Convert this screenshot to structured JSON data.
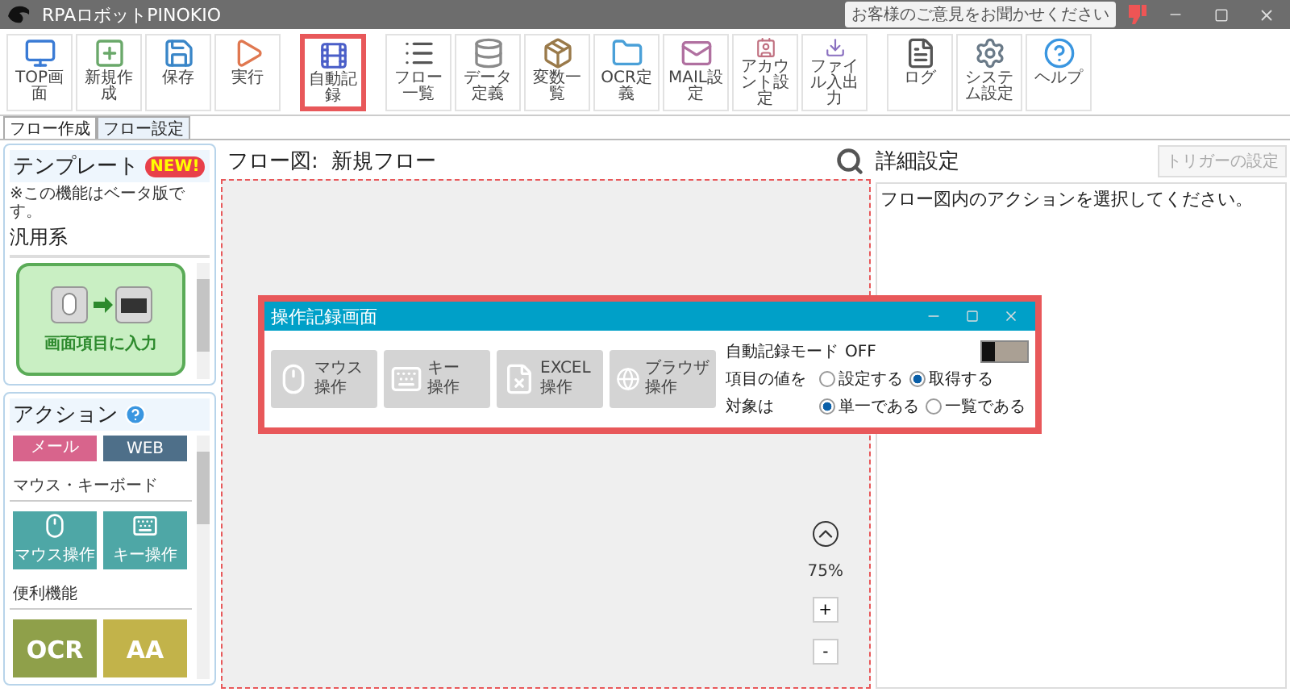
{
  "window": {
    "title": "RPAロボットPINOKIO",
    "feedback": "お客様のご意見をお聞かせください"
  },
  "toolbar_groups": [
    [
      {
        "label": "TOP画面",
        "selected": false
      },
      {
        "label": "新規作成",
        "selected": false
      },
      {
        "label": "保存",
        "selected": false
      },
      {
        "label": "実行",
        "selected": false
      }
    ],
    [
      {
        "label": "自動記録",
        "selected": true
      }
    ],
    [
      {
        "label": "フロー一覧",
        "selected": false
      },
      {
        "label": "データ定義",
        "selected": false
      },
      {
        "label": "変数一覧",
        "selected": false
      },
      {
        "label": "OCR定義",
        "selected": false
      },
      {
        "label": "MAIL設定",
        "selected": false
      },
      {
        "label": "アカウント設定",
        "selected": false
      },
      {
        "label": "ファイル入出力",
        "selected": false
      }
    ],
    [
      {
        "label": "ログ",
        "selected": false
      },
      {
        "label": "システム設定",
        "selected": false
      },
      {
        "label": "ヘルプ",
        "selected": false
      }
    ]
  ],
  "tabs": [
    {
      "label": "フロー作成",
      "selected": true
    },
    {
      "label": "フロー設定",
      "selected": false
    }
  ],
  "templates": {
    "title": "テンプレート",
    "badge": "NEW!",
    "note": "※この機能はベータ版です。",
    "category": "汎用系",
    "cards": [
      {
        "label": "画面項目に入力"
      }
    ]
  },
  "actions": {
    "title": "アクション",
    "groups": [
      {
        "tiles": [
          {
            "label": "メール",
            "color": "#d8648c"
          },
          {
            "label": "WEB",
            "color": "#4e6f89"
          }
        ]
      },
      {
        "heading": "マウス・キーボード",
        "tiles": [
          {
            "label": "マウス操作",
            "color": "#4ea7a6"
          },
          {
            "label": "キー操作",
            "color": "#4ea7a6"
          }
        ]
      },
      {
        "heading": "便利機能",
        "tiles": [
          {
            "label": "OCR",
            "color": "#8fa04a"
          },
          {
            "label": "AA",
            "color": "#c2b34a"
          }
        ]
      }
    ]
  },
  "flow": {
    "title": "フロー図:  新規フロー",
    "zoom": "75%",
    "zoom_in": "+",
    "zoom_out": "-"
  },
  "details": {
    "title": "詳細設定",
    "trigger_button": {
      "label": "トリガーの設定",
      "disabled": true
    },
    "message": "フロー図内のアクションを選択してください。"
  },
  "recorder": {
    "title": "操作記録画面",
    "buttons": [
      {
        "lines": [
          "マウス",
          "操作"
        ]
      },
      {
        "lines": [
          "キー",
          "操作"
        ]
      },
      {
        "lines": [
          "EXCEL",
          "操作"
        ]
      },
      {
        "lines": [
          "ブラウザ",
          "操作"
        ]
      }
    ],
    "mode": {
      "label": "自動記録モード",
      "value": "OFF",
      "on": false
    },
    "radio_rows": [
      {
        "label": "項目の値を",
        "options": [
          {
            "label": "設定する",
            "selected": false
          },
          {
            "label": "取得する",
            "selected": true
          }
        ]
      },
      {
        "label": "対象は",
        "options": [
          {
            "label": "単一である",
            "selected": true
          },
          {
            "label": "一覧である",
            "selected": false
          }
        ]
      }
    ]
  }
}
